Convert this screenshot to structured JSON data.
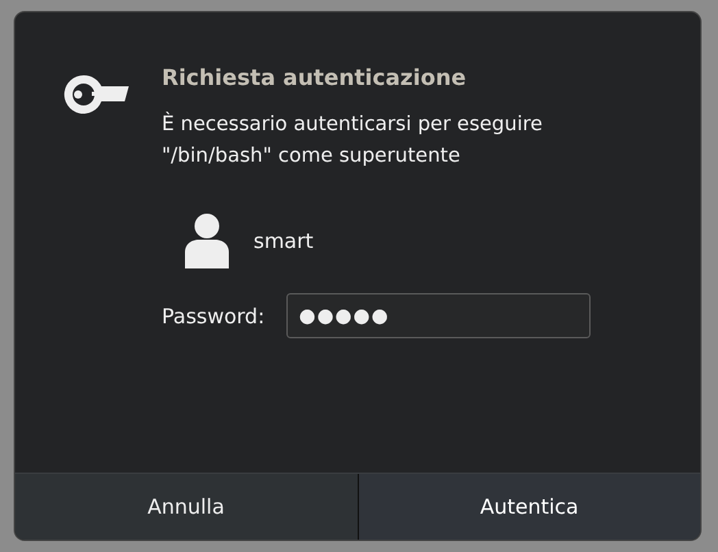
{
  "dialog": {
    "title": "Richiesta autenticazione",
    "message": "È necessario autenticarsi per eseguire \"/bin/bash\" come superutente",
    "user": "smart",
    "password": {
      "label": "Password:",
      "value": "●●●●●"
    },
    "buttons": [
      {
        "label": "Annulla",
        "kind": "cancel"
      },
      {
        "label": "Autentica",
        "kind": "default"
      }
    ]
  }
}
